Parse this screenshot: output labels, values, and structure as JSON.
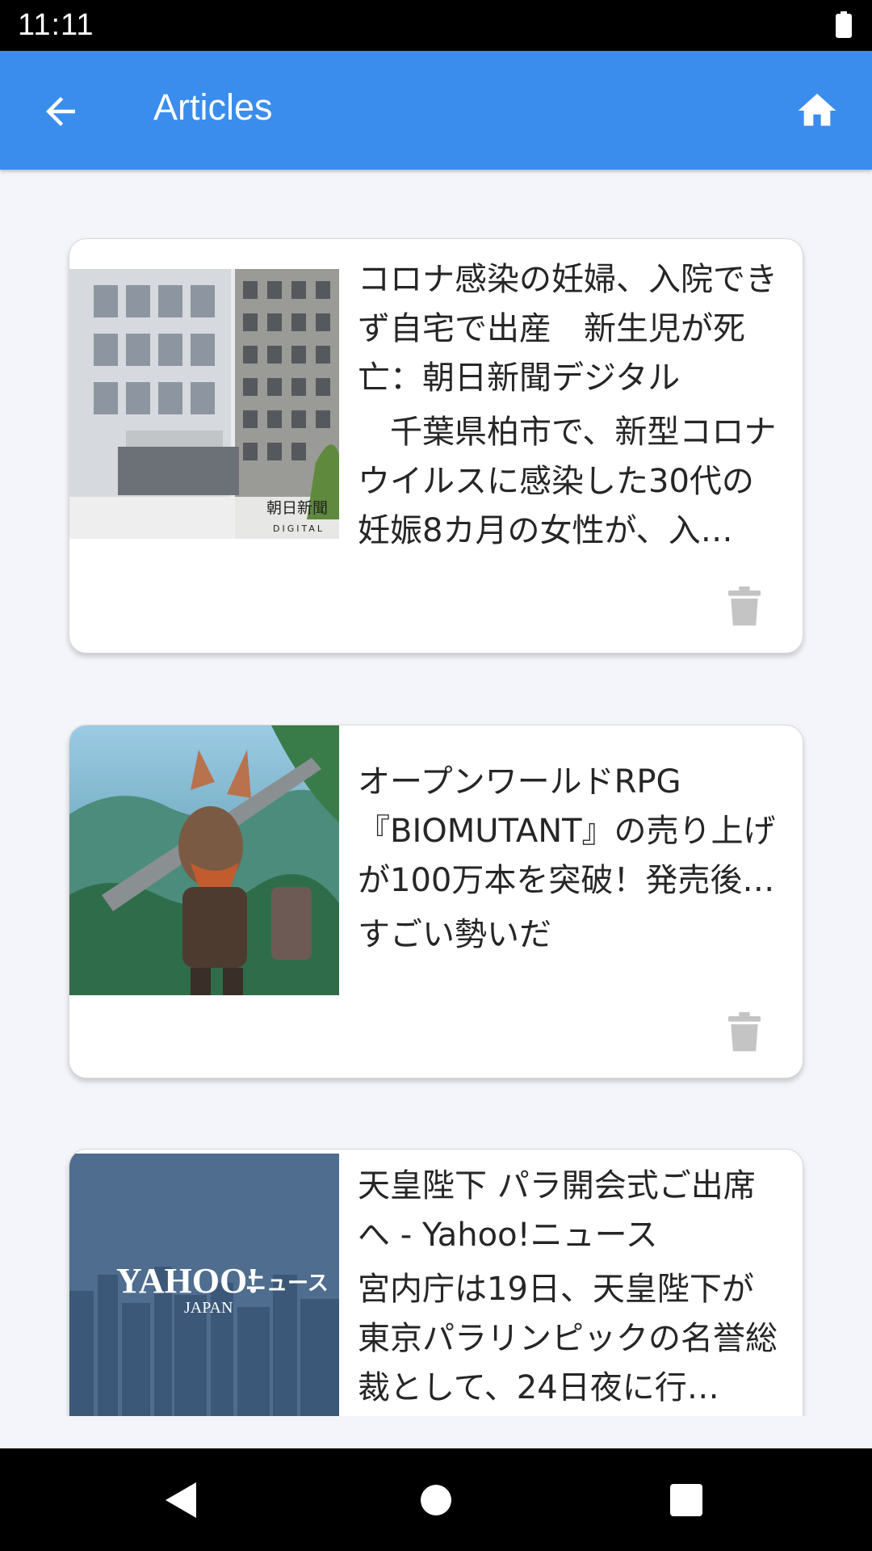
{
  "status_bar": {
    "time": "11:11"
  },
  "app_bar": {
    "title": "Articles",
    "back_icon": "arrow-back-icon",
    "home_icon": "home-icon"
  },
  "articles": [
    {
      "title": "コロナ感染の妊婦、入院できず自宅で出産　新生児が死亡：朝日新聞デジタル",
      "summary": "　千葉県柏市で、新型コロナウイルスに感染した30代の妊娠8カ月の女性が、入…",
      "thumb_caption_1": "朝日新聞",
      "thumb_caption_2": "DIGITAL"
    },
    {
      "title": "オープンワールドRPG『BIOMUTANT』の売り上げが100万本を突破！発売後1…",
      "summary": "すごい勢いだ"
    },
    {
      "title": "天皇陛下 パラ開会式ご出席へ - Yahoo!ニュース",
      "summary": "宮内庁は19日、天皇陛下が東京パラリンピックの名誉総裁として、24日夜に行…",
      "thumb_logo": "YAHOO!",
      "thumb_logo_sub": "ニュース",
      "thumb_logo_japan": "JAPAN"
    }
  ],
  "colors": {
    "app_bar": "#3a8ded",
    "background": "#f4f5fa",
    "trash": "#c4c4c4"
  }
}
